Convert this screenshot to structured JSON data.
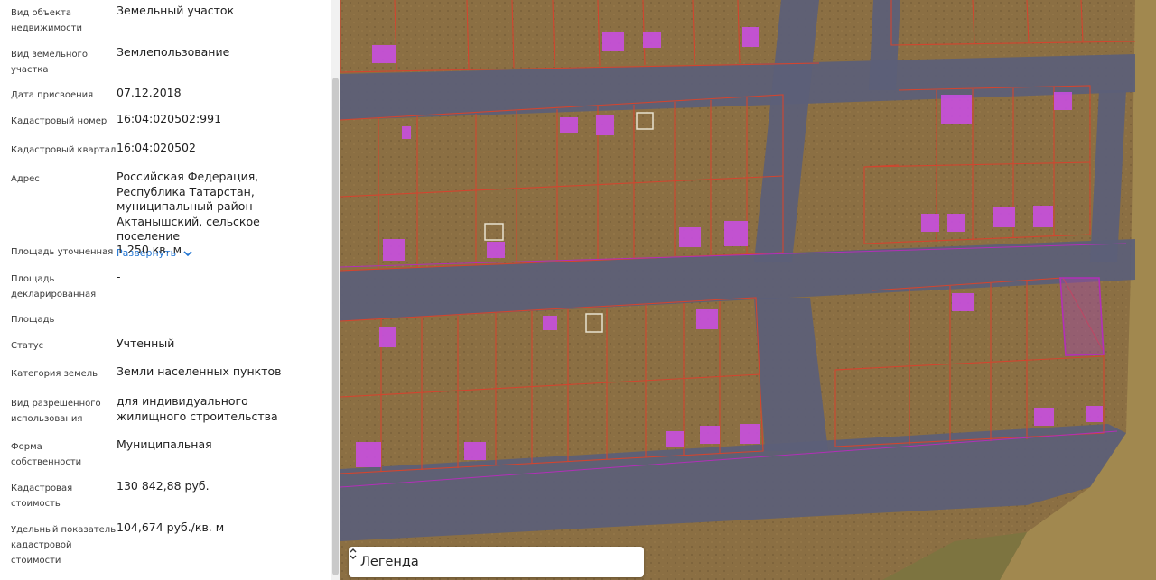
{
  "panel": {
    "rows": [
      {
        "label": "Вид объекта\nнедвижимости",
        "value": "Земельный участок"
      },
      {
        "label": "Вид земельного\nучастка",
        "value": "Землепользование"
      },
      {
        "label": "Дата присвоения",
        "value": "07.12.2018"
      },
      {
        "label": "Кадастровый номер",
        "value": "16:04:020502:991"
      },
      {
        "label": "Кадастровый квартал",
        "value": "16:04:020502"
      },
      {
        "label": "Адрес",
        "value": "Российская Федерация, Республика Татарстан, муниципальный район Актанышский, сельское поселение",
        "expand": "Развернуть"
      },
      {
        "label": "Площадь уточненная",
        "value": "1 250 кв. м"
      },
      {
        "label": "Площадь\nдекларированная",
        "value": "-"
      },
      {
        "label": "Площадь",
        "value": "-"
      },
      {
        "label": "Статус",
        "value": "Учтенный"
      },
      {
        "label": "Категория земель",
        "value": "Земли населенных пунктов"
      },
      {
        "label": "Вид разрешенного\nиспользования",
        "value": "для индивидуального жилищного строительства"
      },
      {
        "label": "Форма\nсобственности",
        "value": "Муниципальная"
      },
      {
        "label": "Кадастровая\nстоимость",
        "value": "130 842,88 руб."
      },
      {
        "label": "Удельный показатель\nкадастровой\nстоимости",
        "value": "104,674 руб./кв. м"
      }
    ]
  },
  "map": {
    "legend_label": "Легенда",
    "colors": {
      "ground": "#8b6f43",
      "road": "#5b5f78",
      "parcel_line": "#d2452f",
      "building": "#c84fe0",
      "selected": "#a24aa8"
    }
  }
}
